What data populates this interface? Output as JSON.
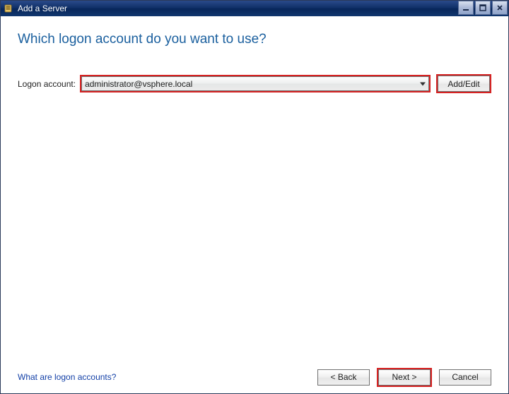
{
  "window": {
    "title": "Add a Server"
  },
  "heading": "Which logon account do you want to use?",
  "form": {
    "logon_label": "Logon account:",
    "logon_value": "administrator@vsphere.local",
    "add_edit_label": "Add/Edit"
  },
  "footer": {
    "help_link": "What are logon accounts?",
    "back_label": "< Back",
    "next_label": "Next >",
    "cancel_label": "Cancel"
  }
}
